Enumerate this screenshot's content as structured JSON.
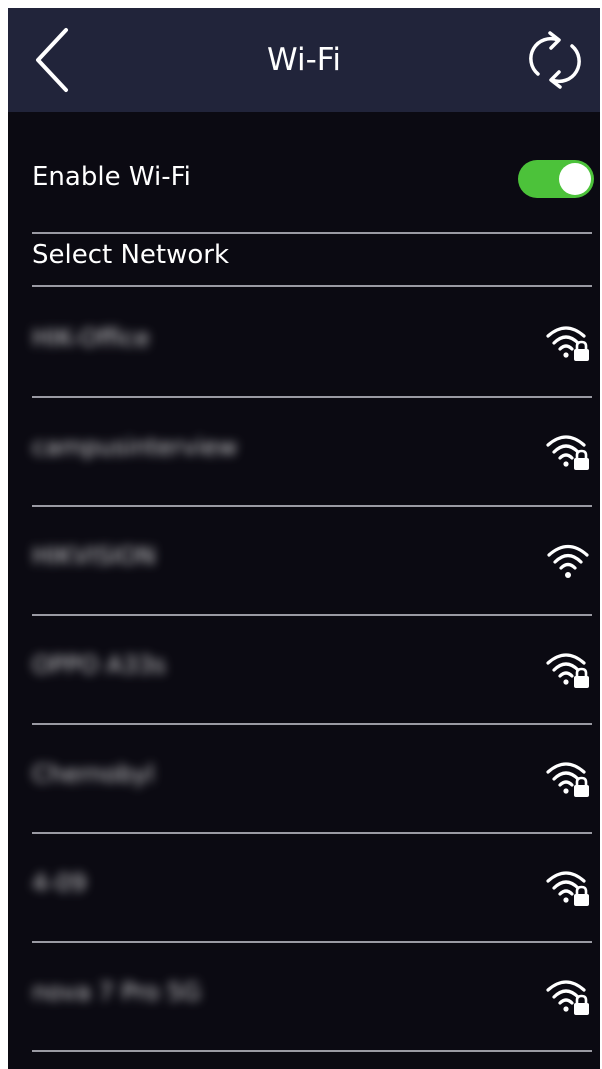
{
  "header": {
    "title": "Wi-Fi"
  },
  "wifi_toggle": {
    "label": "Enable Wi-Fi",
    "enabled": true,
    "color": "#4cc23a"
  },
  "section": {
    "label": "Select Network"
  },
  "networks": [
    {
      "name": "HIK-Office",
      "secured": true,
      "icon": "wifi-lock-icon"
    },
    {
      "name": "campusinterview",
      "secured": true,
      "icon": "wifi-lock-icon"
    },
    {
      "name": "HIKVISION",
      "secured": false,
      "icon": "wifi-icon"
    },
    {
      "name": "OPPO A33s",
      "secured": true,
      "icon": "wifi-lock-icon"
    },
    {
      "name": "Chernobyl",
      "secured": true,
      "icon": "wifi-lock-icon"
    },
    {
      "name": "4-09",
      "secured": true,
      "icon": "wifi-lock-icon"
    },
    {
      "name": "nova 7 Pro 5G",
      "secured": true,
      "icon": "wifi-lock-icon"
    }
  ],
  "colors": {
    "header_bg": "#21243a",
    "screen_bg": "#0b0a12",
    "divider": "#9a9aa3"
  }
}
